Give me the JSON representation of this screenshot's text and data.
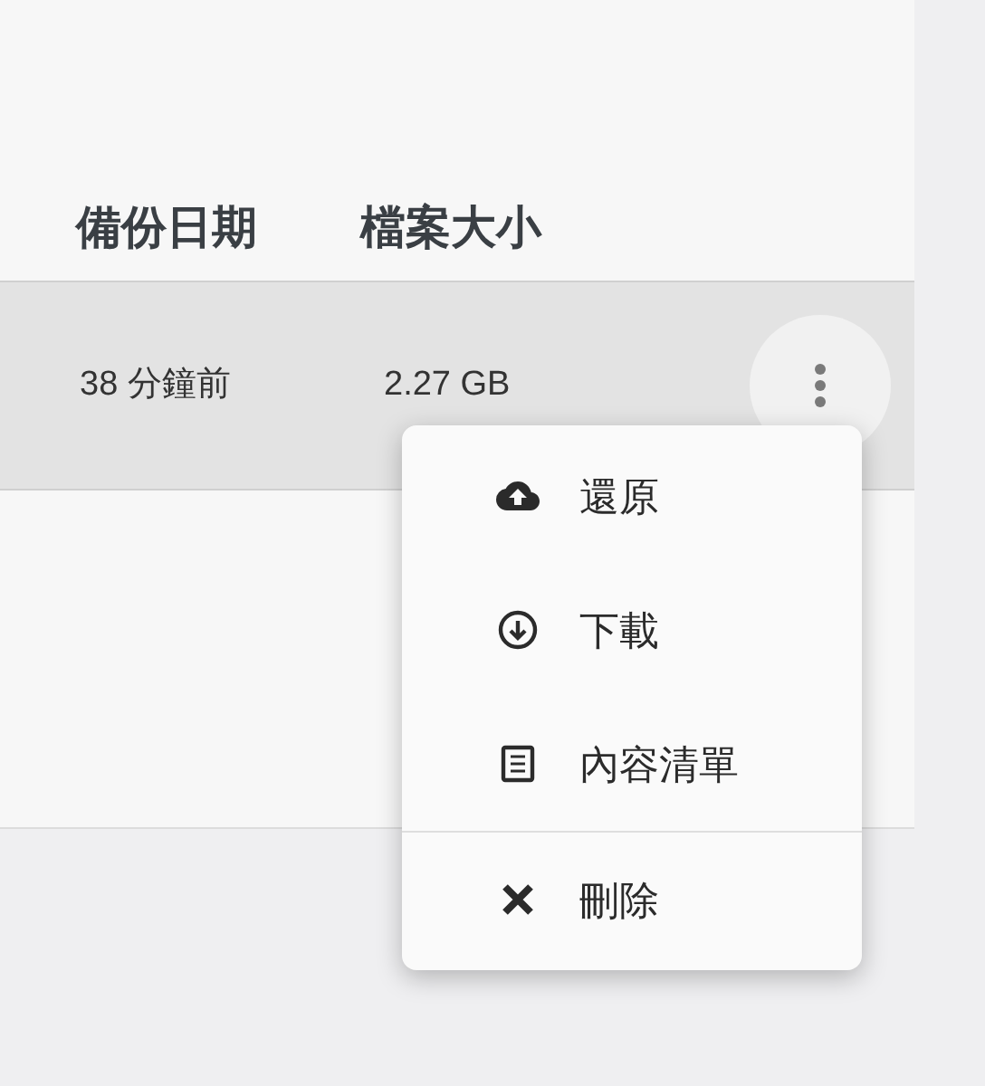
{
  "table": {
    "columns": [
      "備份日期",
      "檔案大小"
    ],
    "rows": [
      {
        "date": "38 分鐘前",
        "size": "2.27 GB",
        "selected": true
      }
    ]
  },
  "menu": {
    "items": [
      {
        "kind": "restore",
        "label": "還原",
        "separated": false
      },
      {
        "kind": "download",
        "label": "下載",
        "separated": false
      },
      {
        "kind": "list",
        "label": "內容清單",
        "separated": false
      },
      {
        "kind": "delete",
        "label": "刪除",
        "separated": true
      }
    ]
  }
}
